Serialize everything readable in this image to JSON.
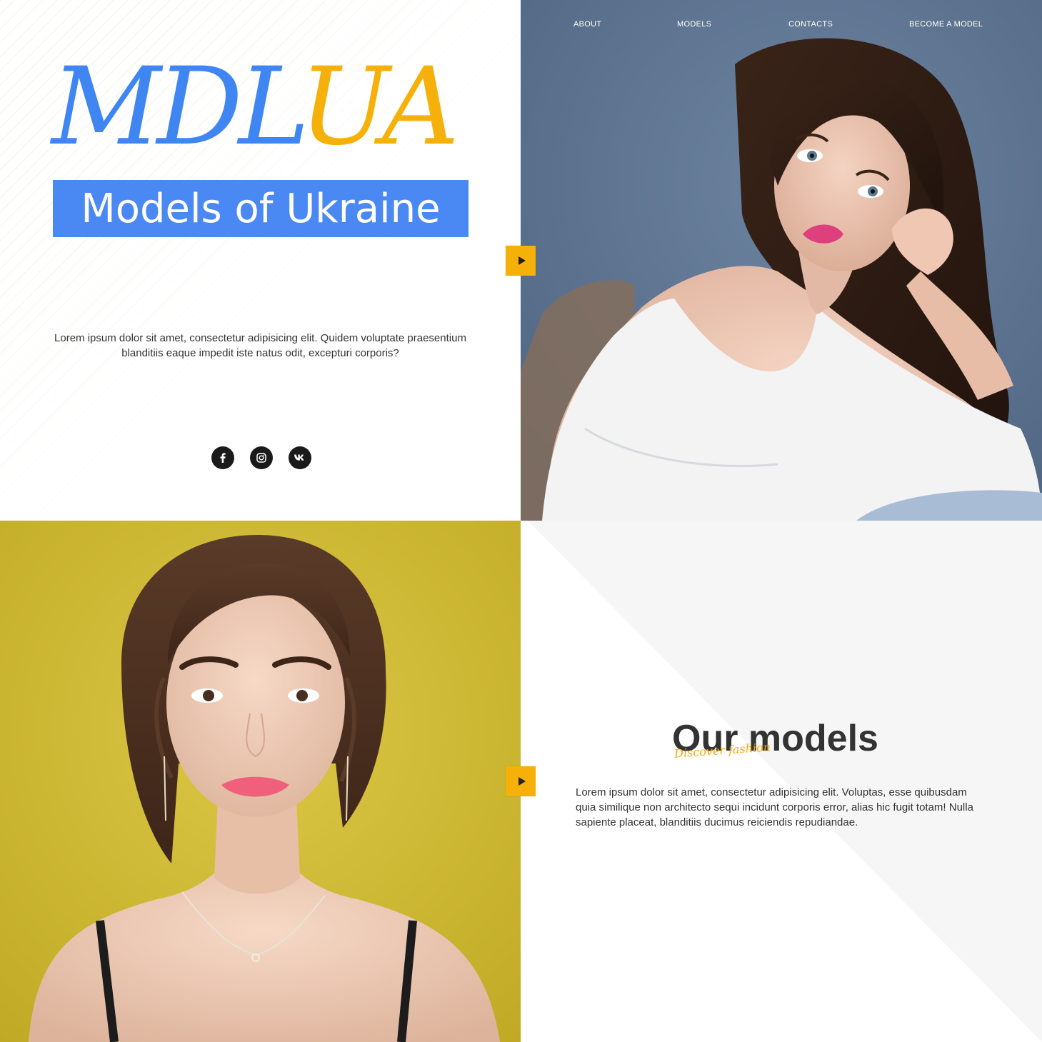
{
  "brand": {
    "logo_part_a": "MDL",
    "logo_part_b": "UA",
    "tagline": "Models of Ukraine",
    "colors": {
      "blue": "#3f86f2",
      "yellow": "#f6b00a",
      "tagline_bg": "#4a88f4"
    }
  },
  "hero": {
    "description": "Lorem ipsum dolor sit amet, consectetur adipisicing elit. Quidem voluptate praesentium blanditiis eaque impedit iste natus odit, excepturi corporis?",
    "social": [
      {
        "name": "facebook",
        "icon": "facebook-icon"
      },
      {
        "name": "instagram",
        "icon": "instagram-icon"
      },
      {
        "name": "vk",
        "icon": "vk-icon"
      }
    ]
  },
  "nav": {
    "items": [
      {
        "label": "ABOUT"
      },
      {
        "label": "MODELS"
      },
      {
        "label": "CONTACTS"
      },
      {
        "label": "BECOME A MODEL"
      }
    ]
  },
  "models_section": {
    "title": "Our models",
    "script_text": "Discover fashion",
    "description": "Lorem ipsum dolor sit amet, consectetur adipisicing elit. Voluptas, esse quibusdam quia similique non architecto sequi incidunt corporis error, alias hic fugit totam! Nulla sapiente placeat, blanditiis ducimus reiciendis repudiandae."
  },
  "slider": {
    "arrow_icon": "play-arrow-icon",
    "accent": "#f6b00a"
  }
}
